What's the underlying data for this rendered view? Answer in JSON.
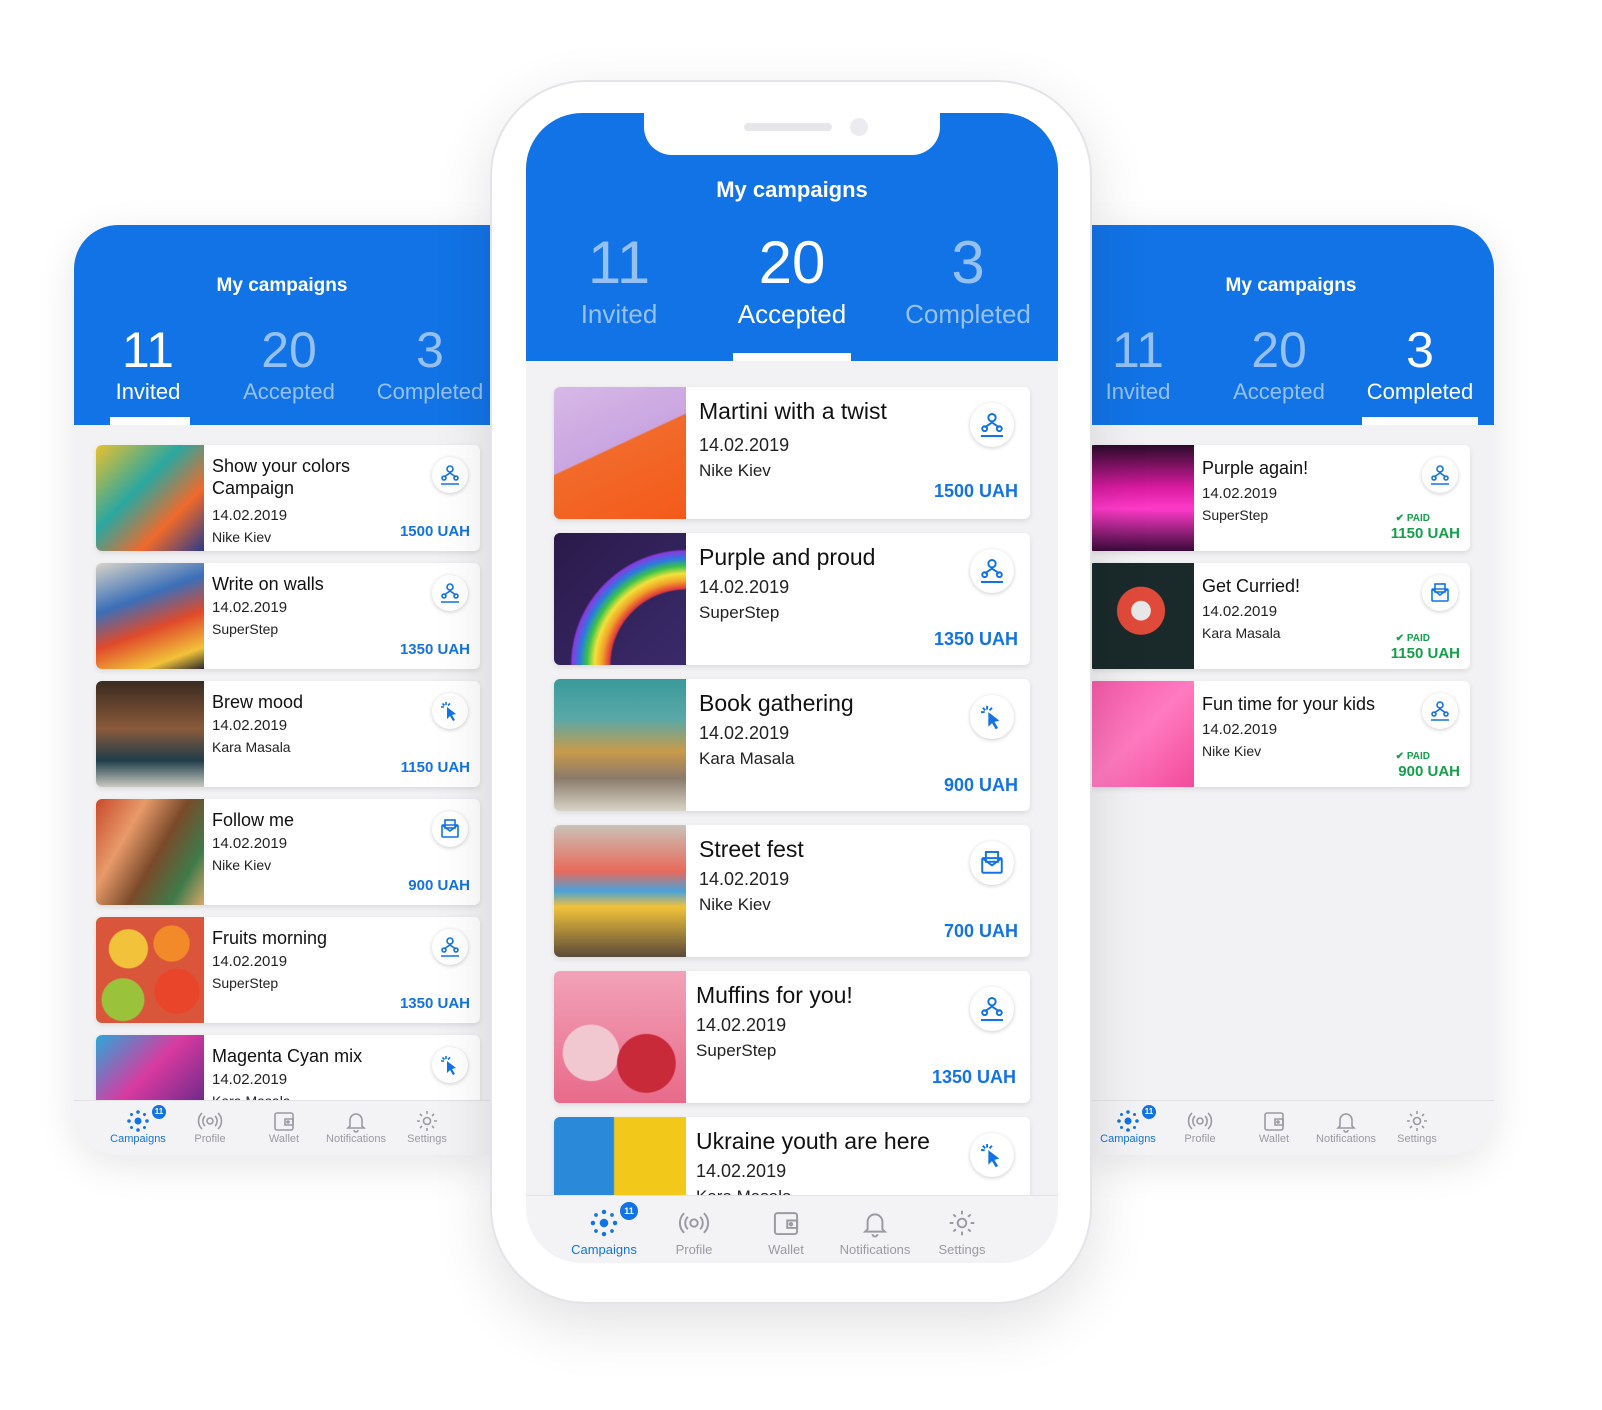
{
  "colors": {
    "accent": "#1273e6",
    "paid": "#13a04a"
  },
  "left": {
    "title": "My campaigns",
    "stats": [
      {
        "num": "11",
        "label": "Invited"
      },
      {
        "num": "20",
        "label": "Accepted"
      },
      {
        "num": "3",
        "label": "Completed"
      }
    ],
    "cards": [
      {
        "title": "Show your colors Campaign",
        "date": "14.02.2019",
        "brand": "Nike Kiev",
        "price": "1500 UAH",
        "icon": "people-icon"
      },
      {
        "title": "Write on walls",
        "date": "14.02.2019",
        "brand": "SuperStep",
        "price": "1350 UAH",
        "icon": "people-icon"
      },
      {
        "title": "Brew mood",
        "date": "14.02.2019",
        "brand": "Kara Masala",
        "price": "1150 UAH",
        "icon": "cursor-click-icon"
      },
      {
        "title": "Follow me",
        "date": "14.02.2019",
        "brand": "Nike Kiev",
        "price": "900 UAH",
        "icon": "mail-icon"
      },
      {
        "title": "Fruits morning",
        "date": "14.02.2019",
        "brand": "SuperStep",
        "price": "1350 UAH",
        "icon": "people-icon"
      },
      {
        "title": "Magenta Cyan mix",
        "date": "14.02.2019",
        "brand": "Kara Masala",
        "price": "",
        "icon": "cursor-click-icon"
      }
    ]
  },
  "center": {
    "title": "My campaigns",
    "stats": [
      {
        "num": "11",
        "label": "Invited"
      },
      {
        "num": "20",
        "label": "Accepted"
      },
      {
        "num": "3",
        "label": "Completed"
      }
    ],
    "cards": [
      {
        "title": "Martini with a twist",
        "date": "14.02.2019",
        "brand": "Nike Kiev",
        "price": "1500 UAH",
        "icon": "people-icon"
      },
      {
        "title": "Purple and proud",
        "date": "14.02.2019",
        "brand": "SuperStep",
        "price": "1350 UAH",
        "icon": "people-icon"
      },
      {
        "title": "Book gathering",
        "date": "14.02.2019",
        "brand": "Kara Masala",
        "price": "900 UAH",
        "icon": "cursor-click-icon"
      },
      {
        "title": "Street fest",
        "date": "14.02.2019",
        "brand": "Nike Kiev",
        "price": "700 UAH",
        "icon": "mail-icon"
      },
      {
        "title": "Muffins for you!",
        "date": "14.02.2019",
        "brand": "SuperStep",
        "price": "1350 UAH",
        "icon": "people-icon"
      },
      {
        "title": "Ukraine youth are here",
        "date": "14.02.2019",
        "brand": "Kara Masala",
        "price": "",
        "icon": "cursor-click-icon"
      }
    ]
  },
  "right": {
    "title": "My campaigns",
    "stats": [
      {
        "num": "11",
        "label": "Invited"
      },
      {
        "num": "20",
        "label": "Accepted"
      },
      {
        "num": "3",
        "label": "Completed"
      }
    ],
    "cards": [
      {
        "title": "Purple again!",
        "date": "14.02.2019",
        "brand": "SuperStep",
        "paid": "PAID",
        "price": "1150 UAH",
        "icon": "people-icon"
      },
      {
        "title": "Get Curried!",
        "date": "14.02.2019",
        "brand": "Kara Masala",
        "paid": "PAID",
        "price": "1150 UAH",
        "icon": "mail-icon"
      },
      {
        "title": "Fun time for your kids",
        "date": "14.02.2019",
        "brand": "Nike Kiev",
        "paid": "PAID",
        "price": "900 UAH",
        "icon": "people-icon"
      }
    ]
  },
  "tabbar": {
    "badge": "11",
    "tabs": [
      {
        "label": "Campaigns",
        "icon": "campaigns-icon"
      },
      {
        "label": "Profile",
        "icon": "broadcast-icon"
      },
      {
        "label": "Wallet",
        "icon": "wallet-icon"
      },
      {
        "label": "Notifications",
        "icon": "bell-icon"
      },
      {
        "label": "Settings",
        "icon": "gear-icon"
      }
    ]
  }
}
